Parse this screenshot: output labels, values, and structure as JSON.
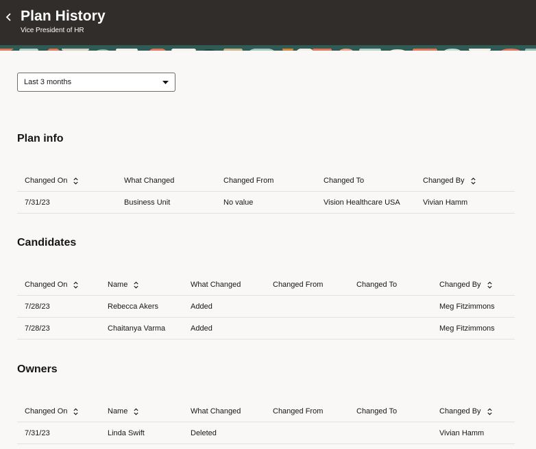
{
  "header": {
    "title": "Plan History",
    "subtitle": "Vice President of HR",
    "back_icon": "chevron-left-icon",
    "background": "#312d2a"
  },
  "filter": {
    "selected": "Last 3 months",
    "icon": "caret-down-icon"
  },
  "sections": {
    "plan_info": {
      "title": "Plan info",
      "columns": [
        "Changed On",
        "What Changed",
        "Changed From",
        "Changed To",
        "Changed By"
      ],
      "sortable": [
        true,
        false,
        false,
        false,
        true
      ],
      "rows": [
        [
          "7/31/23",
          "Business Unit",
          "No value",
          "Vision Healthcare USA",
          "Vivian Hamm"
        ]
      ]
    },
    "candidates": {
      "title": "Candidates",
      "columns": [
        "Changed On",
        "Name",
        "What Changed",
        "Changed From",
        "Changed To",
        "Changed By"
      ],
      "sortable": [
        true,
        true,
        false,
        false,
        false,
        true
      ],
      "rows": [
        [
          "7/28/23",
          "Rebecca Akers",
          "Added",
          "",
          "",
          "Meg Fitzimmons"
        ],
        [
          "7/28/23",
          "Chaitanya Varma",
          "Added",
          "",
          "",
          "Meg Fitzimmons"
        ]
      ]
    },
    "owners": {
      "title": "Owners",
      "columns": [
        "Changed On",
        "Name",
        "What Changed",
        "Changed From",
        "Changed To",
        "Changed By"
      ],
      "sortable": [
        true,
        true,
        false,
        false,
        false,
        true
      ],
      "rows": [
        [
          "7/31/23",
          "Linda Swift",
          "Deleted",
          "",
          "",
          "Vivian Hamm"
        ]
      ]
    }
  }
}
